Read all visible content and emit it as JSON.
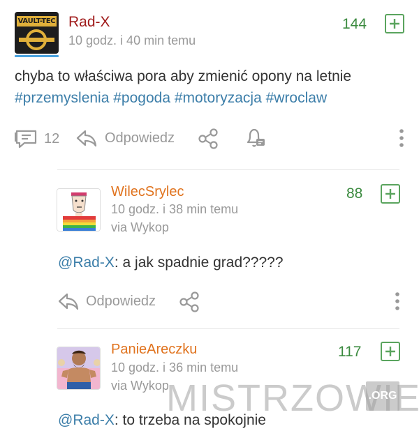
{
  "post": {
    "author": "Rad-X",
    "time": "10 godz. i 40 min temu",
    "score": "144",
    "avatar_label": "VAULT-TEC",
    "body_text": "chyba to właściwa pora aby zmienić opony na letnie",
    "tags": [
      "#przemyslenia",
      "#pogoda",
      "#motoryzacja",
      "#wroclaw"
    ],
    "comment_count": "12",
    "reply_label": "Odpowiedz"
  },
  "comments": [
    {
      "author": "WilecSrylec",
      "time": "10 godz. i 38 min temu",
      "via": "via Wykop",
      "score": "88",
      "mention": "@Rad-X",
      "text": ": a jak spadnie grad?????",
      "reply_label": "Odpowiedz"
    },
    {
      "author": "PanieAreczku",
      "time": "10 godz. i 36 min temu",
      "via": "via Wykop",
      "score": "117",
      "mention": "@Rad-X",
      "text": ": to trzeba na spokojnie"
    }
  ],
  "watermark": {
    "text": "MISTRZOWIE",
    "suffix": ".ORG"
  },
  "colors": {
    "author_main": "#a01b1b",
    "author_comment": "#e0731e",
    "score": "#3b8a3f",
    "tag": "#3c7ea9"
  }
}
